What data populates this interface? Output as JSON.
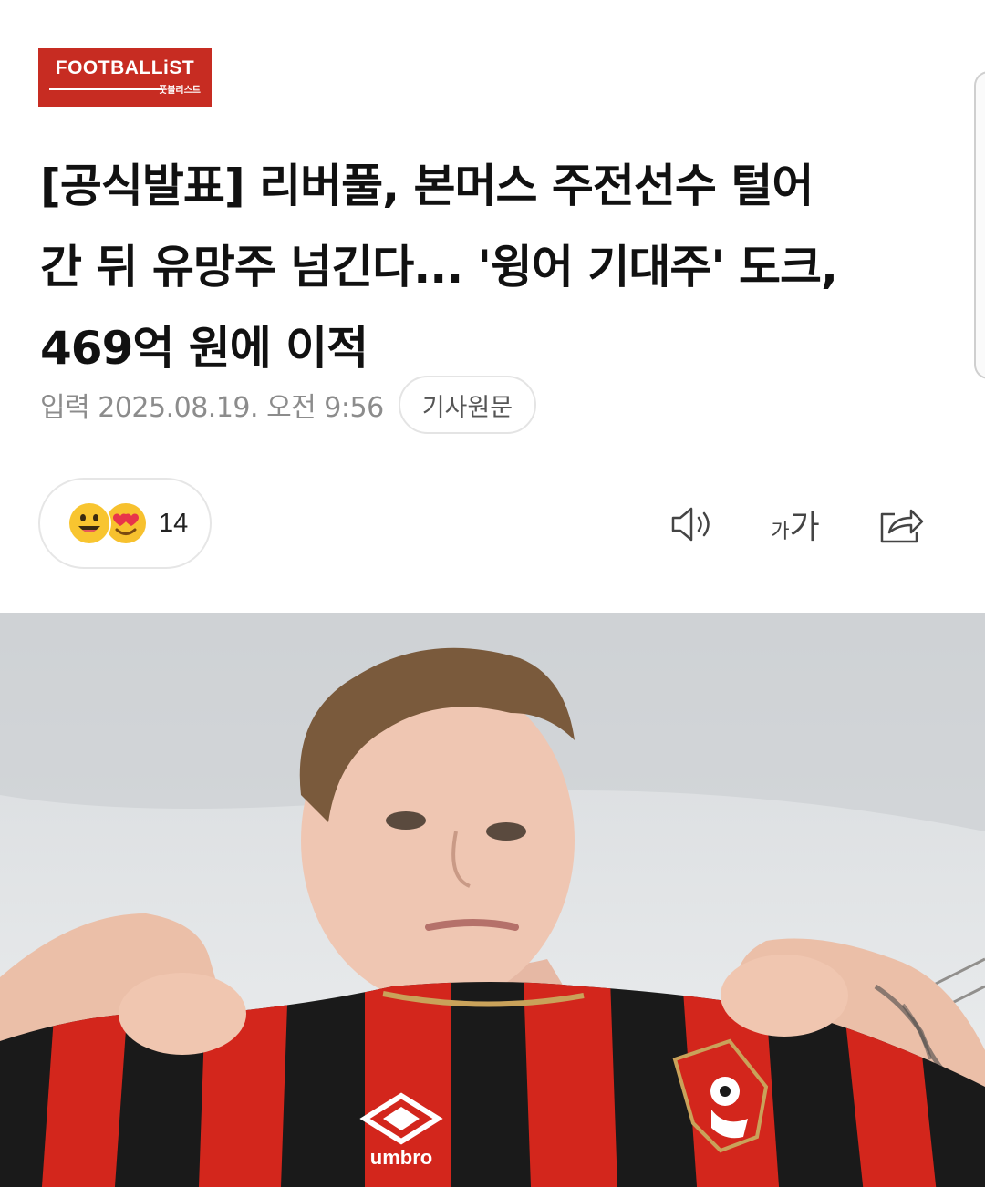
{
  "logo": {
    "brand": "FOOTBALLiST",
    "sub": "풋볼리스트"
  },
  "article": {
    "headline_lines": [
      "[공식발표] 리버풀, 본머스 주전선수 털어",
      "간 뒤 유망주 넘긴다... '윙어 기대주' 도크,",
      "469억 원에 이적"
    ],
    "date": "입력 2025.08.19. 오전 9:56",
    "original_button": "기사원문"
  },
  "reactions": {
    "icons": [
      "smile-emoji",
      "heart-eyes-emoji"
    ],
    "count": "14"
  },
  "tools": {
    "tts_icon": "speaker-icon",
    "font_size_small": "가",
    "font_size_large": "가",
    "share_icon": "share-icon"
  },
  "photo": {
    "jersey_brand": "umbro"
  },
  "colors": {
    "brand_red": "#c72c22",
    "meta_gray": "#8c8c8c",
    "jersey_red": "#d3261c",
    "jersey_black": "#1a1a1a"
  }
}
